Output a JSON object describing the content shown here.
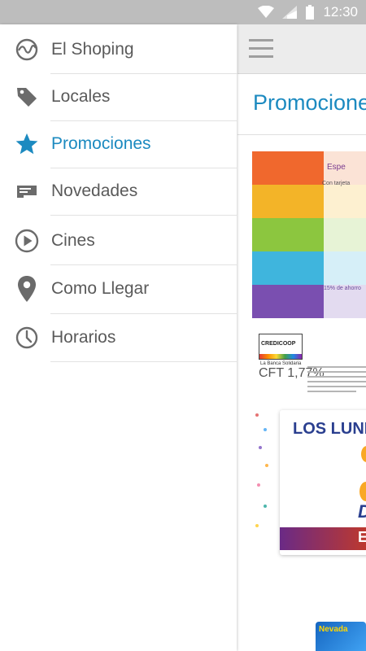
{
  "status_bar": {
    "time": "12:30",
    "icons": [
      "wifi-icon",
      "signal-icon",
      "battery-icon"
    ]
  },
  "drawer": {
    "items": [
      {
        "label": "El Shoping",
        "icon": "globe-icon",
        "active": false
      },
      {
        "label": "Locales",
        "icon": "tag-icon",
        "active": false
      },
      {
        "label": "Promociones",
        "icon": "star-icon",
        "active": true
      },
      {
        "label": "Novedades",
        "icon": "news-icon",
        "active": false
      },
      {
        "label": "Cines",
        "icon": "play-icon",
        "active": false
      },
      {
        "label": "Como Llegar",
        "icon": "location-pin-icon",
        "active": false
      },
      {
        "label": "Horarios",
        "icon": "clock-icon",
        "active": false
      }
    ]
  },
  "app": {
    "toolbar_icon": "hamburger-menu-icon",
    "title": "Promociones",
    "promos": [
      {
        "headline": "Espe",
        "subline": "Con tarjeta",
        "discount_text": "15% de ahorro",
        "bank_logo": "CREDICOOP",
        "bank_tagline": "La Banca Solidaria",
        "cft": "CFT 1,77%"
      },
      {
        "headline": "LOS LUNE",
        "brand_initial": "D",
        "band_text": "E"
      },
      {
        "card_label": "Nevada"
      }
    ]
  },
  "colors": {
    "accent": "#1c8ac0",
    "status_bar": "#bdbdbd",
    "menu_text": "#5a5a5a"
  }
}
